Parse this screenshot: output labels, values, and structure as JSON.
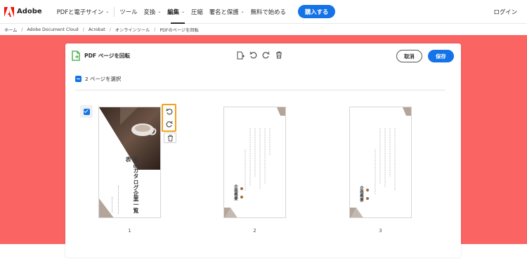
{
  "brand": {
    "name": "Adobe",
    "color": "#fa0f00"
  },
  "nav": {
    "items": [
      {
        "label": "PDFと電子サイン",
        "has_dropdown": true,
        "active": false
      },
      {
        "label": "ツール",
        "has_dropdown": false,
        "active": false
      },
      {
        "label": "変換",
        "has_dropdown": true,
        "active": false
      },
      {
        "label": "編集",
        "has_dropdown": true,
        "active": true
      },
      {
        "label": "圧縮",
        "has_dropdown": false,
        "active": false
      },
      {
        "label": "署名と保護",
        "has_dropdown": true,
        "active": false
      },
      {
        "label": "無料で始める",
        "has_dropdown": false,
        "active": false
      }
    ],
    "buy_label": "購入する",
    "login_label": "ログイン"
  },
  "breadcrumb": [
    "ホーム",
    "Adobe Document Cloud",
    "Acrobat",
    "オンラインツール",
    "PDFのページを回転"
  ],
  "colors": {
    "hero": "#fa6463",
    "accent": "#1473e6",
    "highlight": "#f5a01a"
  },
  "card": {
    "title": "PDF ページを回転",
    "toolbar_icons": [
      "insert-page-icon",
      "rotate-left-icon",
      "rotate-right-icon",
      "trash-icon"
    ],
    "cancel_label": "取消",
    "save_label": "保存",
    "select_label": "2 ページを選択"
  },
  "pages": [
    {
      "number": "1",
      "selected": true,
      "title_text": "商品カタログ企業一覧表"
    },
    {
      "number": "2",
      "selected": false,
      "title_text": "企画概要"
    },
    {
      "number": "3",
      "selected": false,
      "title_text": "企画概要"
    }
  ]
}
